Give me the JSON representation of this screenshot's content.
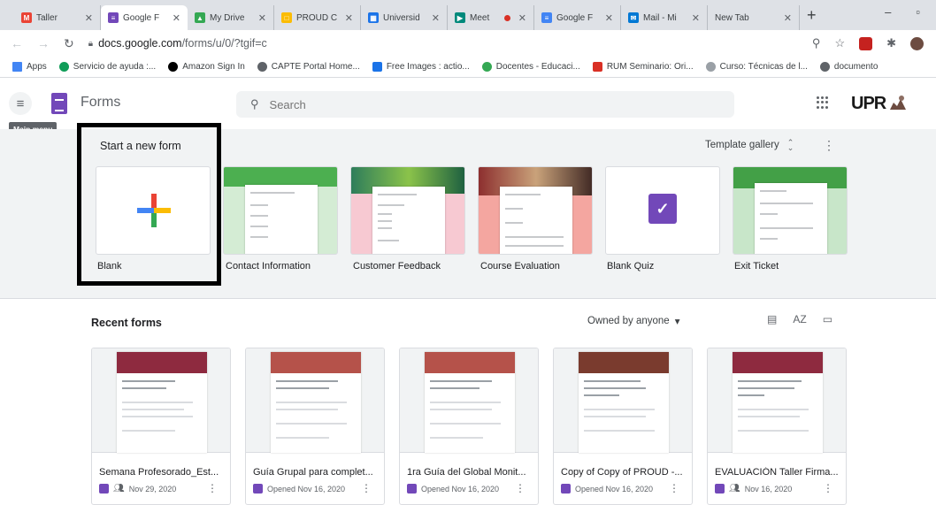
{
  "browser": {
    "tabs": [
      {
        "label": "M",
        "title": "Taller",
        "color": "#ea4335",
        "icon": "gmail-icon"
      },
      {
        "label": "",
        "title": "Google F",
        "color": "#7248b9",
        "icon": "forms-icon",
        "active": true
      },
      {
        "label": "",
        "title": "My Drive",
        "color": "#34a853",
        "icon": "drive-icon"
      },
      {
        "label": "",
        "title": "PROUD C",
        "color": "#fbbc04",
        "icon": "slides-icon"
      },
      {
        "label": "",
        "title": "Universid",
        "color": "#1a73e8",
        "icon": "calendar-icon"
      },
      {
        "label": "",
        "title": "Meet",
        "color": "#00897b",
        "icon": "meet-icon",
        "recording": true
      },
      {
        "label": "",
        "title": "Google F",
        "color": "#4285f4",
        "icon": "docs-icon"
      },
      {
        "label": "",
        "title": "Mail - Mi",
        "color": "#0078d4",
        "icon": "outlook-icon"
      },
      {
        "label": "",
        "title": "New Tab",
        "color": "",
        "icon": ""
      }
    ],
    "new_tab": "+",
    "window_controls": [
      "–",
      "▫"
    ],
    "url_host": "docs.google.com",
    "url_path": "/forms/u/0/?tgif=c",
    "bookmarks": [
      {
        "label": "Apps",
        "color": "#4285f4"
      },
      {
        "label": "Servicio de ayuda :...",
        "color": "#0f9d58"
      },
      {
        "label": "Amazon Sign In",
        "color": "#000000"
      },
      {
        "label": "CAPTE Portal Home...",
        "color": "#5f6368"
      },
      {
        "label": "Free Images : actio...",
        "color": "#1a73e8"
      },
      {
        "label": "Docentes - Educaci...",
        "color": "#34a853"
      },
      {
        "label": "RUM Seminario: Ori...",
        "color": "#d93025"
      },
      {
        "label": "Curso: Técnicas de l...",
        "color": "#9aa0a6"
      },
      {
        "label": "documento",
        "color": "#5f6368"
      }
    ]
  },
  "app": {
    "name": "Forms",
    "search_placeholder": "Search",
    "brand": "UPR",
    "tooltip": "Main menu"
  },
  "templates": {
    "start_label": "Start a new form",
    "gallery_label": "Template gallery",
    "items": [
      {
        "label": "Blank"
      },
      {
        "label": "Contact Information"
      },
      {
        "label": "Customer Feedback"
      },
      {
        "label": "Course Evaluation"
      },
      {
        "label": "Blank Quiz"
      },
      {
        "label": "Exit Ticket"
      }
    ]
  },
  "recent": {
    "title": "Recent forms",
    "owner_filter": "Owned by anyone",
    "sort_label": "AZ",
    "forms": [
      {
        "name": "Semana Profesorado_Est...",
        "meta": "Nov 29, 2020",
        "shared": true,
        "banner": "#8e2a3f"
      },
      {
        "name": "Guía Grupal para complet...",
        "meta": "Opened Nov 16, 2020",
        "shared": false,
        "banner": "#b5524a"
      },
      {
        "name": "1ra Guía del Global Monit...",
        "meta": "Opened Nov 16, 2020",
        "shared": false,
        "banner": "#b5524a"
      },
      {
        "name": "Copy of Copy of PROUD -...",
        "meta": "Opened Nov 16, 2020",
        "shared": false,
        "banner": "#7a3b2e"
      },
      {
        "name": "EVALUACIÓN Taller Firma...",
        "meta": "Nov 16, 2020",
        "shared": true,
        "banner": "#8e2a3f"
      }
    ]
  }
}
